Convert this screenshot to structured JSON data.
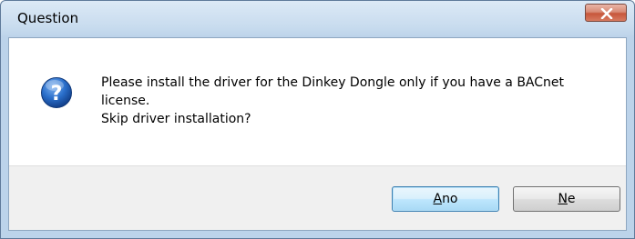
{
  "window": {
    "title": "Question"
  },
  "icons": {
    "close": "close-icon",
    "question": "question-icon"
  },
  "message": {
    "line1": "Please install the driver for the Dinkey Dongle only if you have a BACnet",
    "line2": "license.",
    "line3": "Skip driver installation?"
  },
  "buttons": {
    "yes": {
      "mnemonic": "A",
      "rest": "no"
    },
    "no": {
      "mnemonic": "N",
      "rest": "e"
    }
  },
  "colors": {
    "title_gradient_top": "#dce9f6",
    "title_gradient_bottom": "#bcd3ea",
    "close_button_red": "#c7563b",
    "footer_gray": "#f0f0f0",
    "default_button_border": "#3c7fb1",
    "question_icon_blue": "#1f5fb8"
  }
}
